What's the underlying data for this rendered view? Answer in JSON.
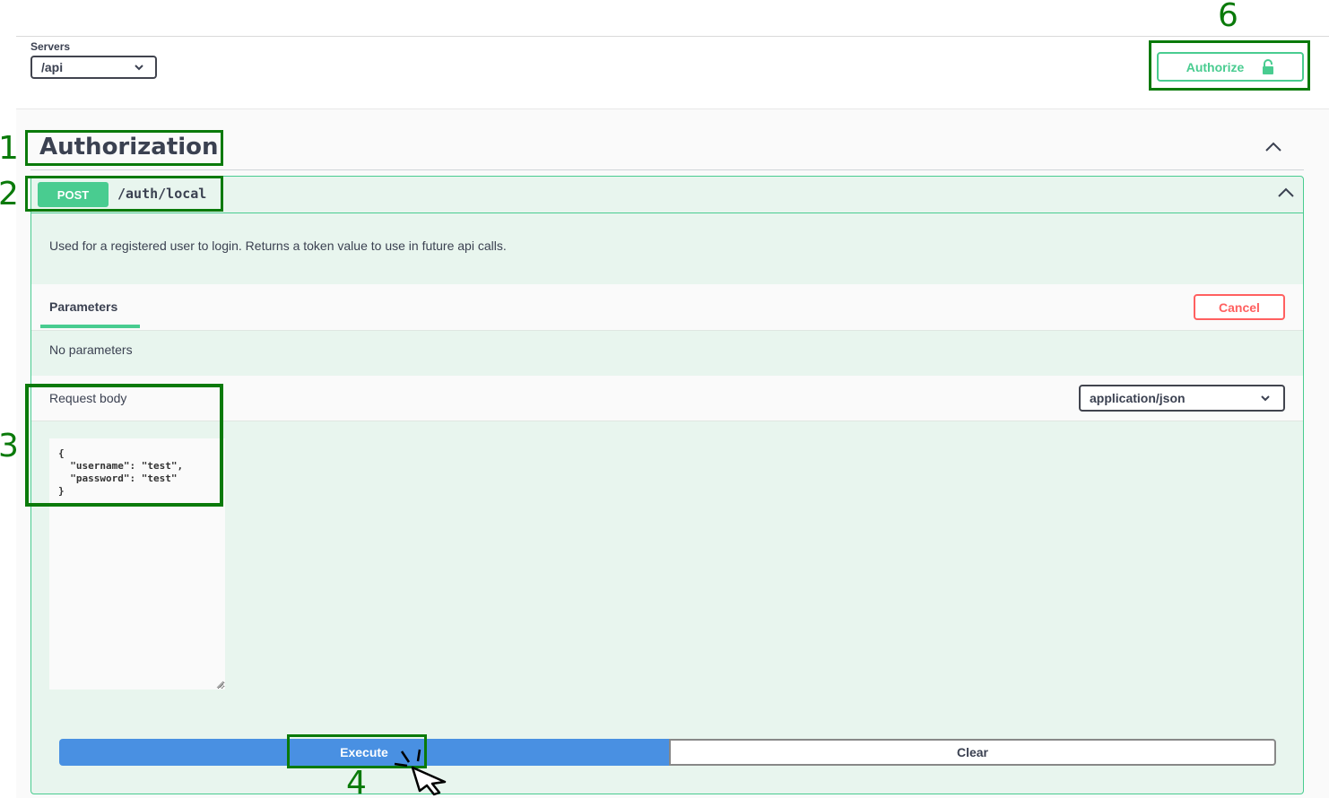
{
  "servers": {
    "label": "Servers",
    "selected": "/api"
  },
  "auth_button": {
    "label": "Authorize",
    "icon": "lock-icon"
  },
  "section": {
    "title": "Authorization",
    "toggle_icon": "chevron-up-icon"
  },
  "operation": {
    "method": "POST",
    "path": "/auth/local",
    "description": "Used for a registered user to login. Returns a token value to use in future api calls.",
    "parameters_tab": "Parameters",
    "cancel_label": "Cancel",
    "no_parameters": "No parameters",
    "request_body_label": "Request body",
    "content_type": "application/json",
    "request_body": "{\n  \"username\": \"test\",\n  \"password\": \"test\"\n}",
    "execute_label": "Execute",
    "clear_label": "Clear"
  },
  "annotations": {
    "n1": "1",
    "n2": "2",
    "n3": "3",
    "n4": "4",
    "n6": "6"
  },
  "colors": {
    "post_green": "#49cc90",
    "execute_blue": "#4990e2",
    "cancel_red": "#ff6060",
    "annotation_green": "#0a7a0a"
  }
}
